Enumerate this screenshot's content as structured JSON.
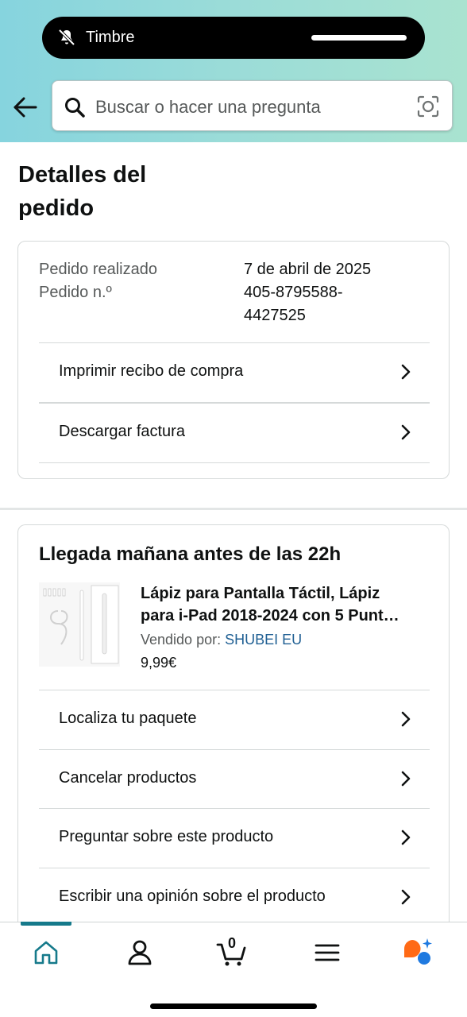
{
  "notification": {
    "label": "Timbre",
    "icon": "bell-slash-icon"
  },
  "search": {
    "placeholder": "Buscar o hacer una pregunta"
  },
  "page": {
    "title": "Detalles del pedido"
  },
  "order_info": {
    "placed_label": "Pedido realizado",
    "placed_value": "7 de abril de 2025",
    "number_label": "Pedido n.º",
    "number_value": "405-8795588-4427525"
  },
  "order_actions": [
    {
      "label": "Imprimir recibo de compra"
    },
    {
      "label": "Descargar factura"
    }
  ],
  "shipment": {
    "heading": "Llegada mañana antes de las 22h",
    "product": {
      "title_line1": "Lápiz para Pantalla Táctil, Lápiz",
      "title_line2": "para i-Pad 2018-2024 con 5 Punt…",
      "sold_by_label": "Vendido por:",
      "seller": "SHUBEI EU",
      "price": "9,99€"
    },
    "actions": [
      {
        "label": "Localiza tu paquete"
      },
      {
        "label": "Cancelar productos"
      },
      {
        "label": "Preguntar sobre este producto"
      },
      {
        "label": "Escribir una opinión sobre el producto"
      }
    ]
  },
  "tabbar": {
    "tabs": [
      "home-icon",
      "account-icon",
      "cart-icon",
      "menu-icon",
      "assistant-icon"
    ],
    "cart_count": "0",
    "active_color": "#167a8b"
  },
  "colors": {
    "seller_link": "#1f5f93",
    "header_gradient_start": "#86d4de",
    "header_gradient_end": "#a9e3d0"
  }
}
